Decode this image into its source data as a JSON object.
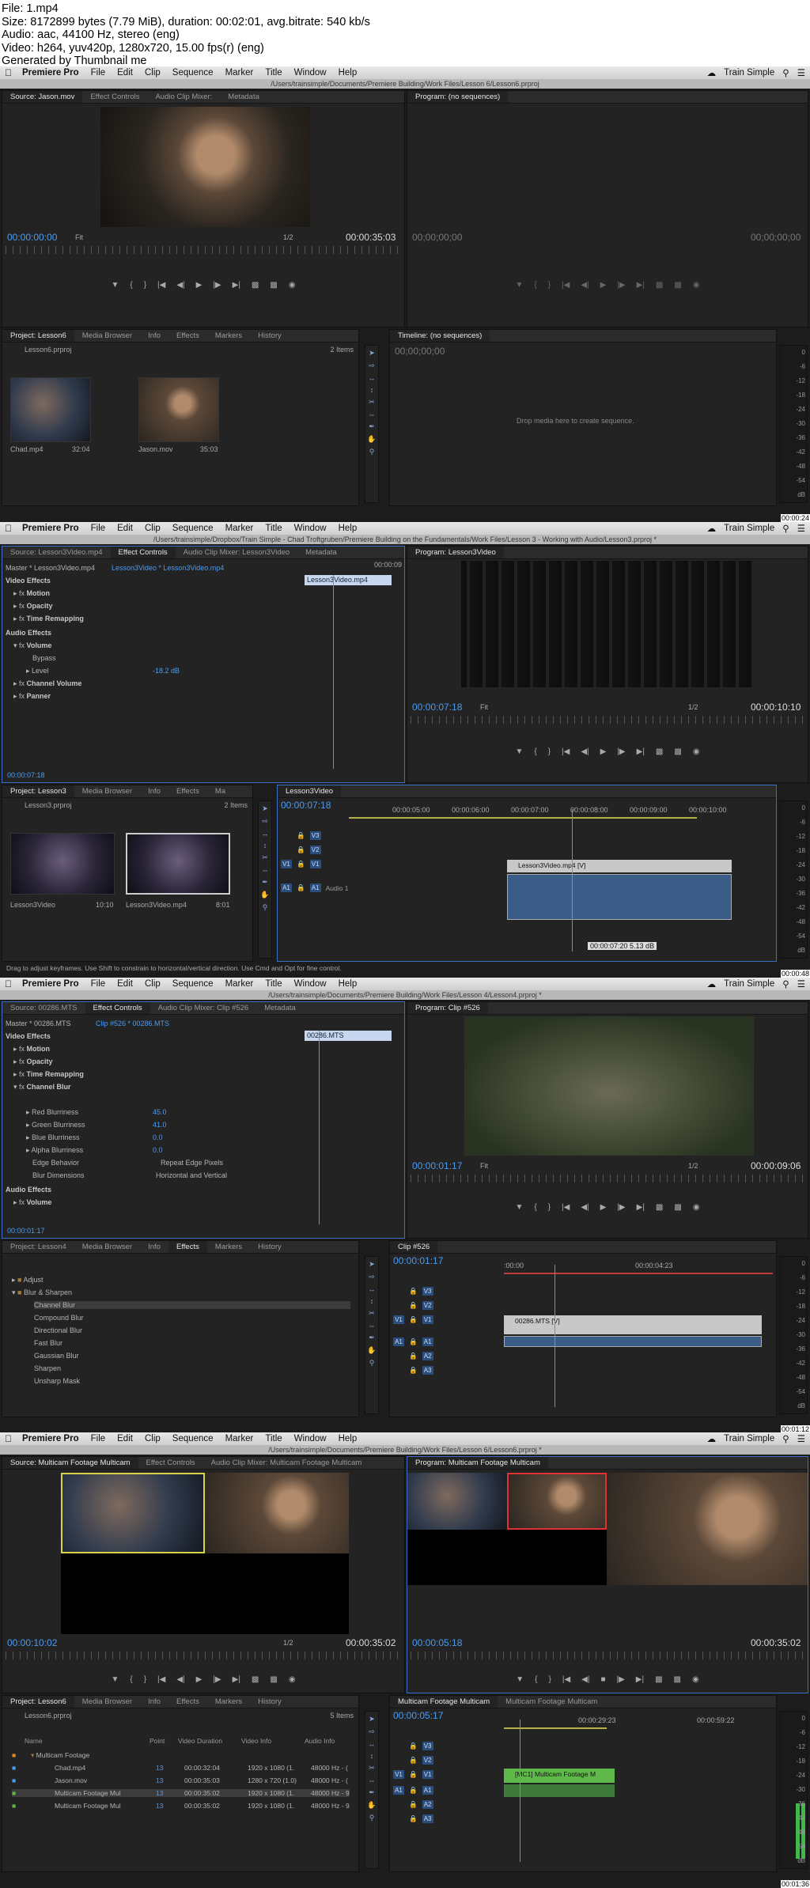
{
  "header": {
    "file": "File: 1.mp4",
    "size": "Size: 8172899 bytes (7.79 MiB), duration: 00:02:01, avg.bitrate: 540 kb/s",
    "audio": "Audio: aac, 44100 Hz, stereo (eng)",
    "video": "Video: h264, yuv420p, 1280x720, 15.00 fps(r) (eng)",
    "generator": "Generated by Thumbnail me"
  },
  "menubar": {
    "app": "Premiere Pro",
    "items": [
      "File",
      "Edit",
      "Clip",
      "Sequence",
      "Marker",
      "Title",
      "Window",
      "Help"
    ],
    "right": "Train Simple"
  },
  "frames": [
    {
      "path": "/Users/trainsimple/Documents/Premiere Building/Work Files/Lesson 6/Lesson6.prproj",
      "timestamp": "00:00:24",
      "source_tabs": [
        "Source: Jason.mov",
        "Effect Controls",
        "Audio Clip Mixer:",
        "Metadata"
      ],
      "program_tab": "Program: (no sequences)",
      "source_tc": "00:00:00:00",
      "fit": "Fit",
      "res": "1/2",
      "source_dur": "00:00:35:03",
      "program_tc_left": "00;00;00;00",
      "program_tc_right": "00;00;00;00",
      "project_tabs": [
        "Project: Lesson6",
        "Media Browser",
        "Info",
        "Effects",
        "Markers",
        "History"
      ],
      "project_file": "Lesson6.prproj",
      "items_count": "2 Items",
      "thumbs": [
        {
          "name": "Chad.mp4",
          "dur": "32:04"
        },
        {
          "name": "Jason.mov",
          "dur": "35:03"
        }
      ],
      "timeline_tab": "Timeline: (no sequences)",
      "timeline_tc": "00;00;00;00",
      "drop_msg": "Drop media here to create sequence."
    },
    {
      "path": "/Users/trainsimple/Dropbox/Train Simple - Chad Troftgruben/Premiere Building on the Fundamentals/Work Files/Lesson 3 - Working with Audio/Lesson3.prproj *",
      "timestamp": "00:00:48",
      "source_tabs": [
        "Source: Lesson3Video.mp4",
        "Effect Controls",
        "Audio Clip Mixer: Lesson3Video",
        "Metadata"
      ],
      "program_tab": "Program: Lesson3Video",
      "ec_master": "Master * Lesson3Video.mp4",
      "ec_clip": "Lesson3Video * Lesson3Video.mp4",
      "ec_time": "00:00:09",
      "ec_cliplabel": "Lesson3Video.mp4",
      "ec_rows": [
        "Video Effects",
        "Motion",
        "Opacity",
        "Time Remapping",
        "Audio Effects",
        "Volume",
        "Bypass",
        "Level",
        "Channel Volume",
        "Panner"
      ],
      "level_value": "-18.2 dB",
      "ec_tc": "00:00:07:18",
      "program_tc": "00:00:07:18",
      "fit": "Fit",
      "res": "1/2",
      "program_dur": "00:00:10:10",
      "project_tabs": [
        "Project: Lesson3",
        "Media Browser",
        "Info",
        "Effects",
        "Ma"
      ],
      "project_file": "Lesson3.prproj",
      "items_count": "2 Items",
      "thumbs": [
        {
          "name": "Lesson3Video",
          "dur": "10:10"
        },
        {
          "name": "Lesson3Video.mp4",
          "dur": "8:01"
        }
      ],
      "timeline_tab": "Lesson3Video",
      "timeline_tc": "00:00:07:18",
      "ruler_labels": [
        "00:00:05:00",
        "00:00:06:00",
        "00:00:07:00",
        "00:00:08:00",
        "00:00:09:00",
        "00:00:10:00"
      ],
      "tracks_v": [
        "V3",
        "V2",
        "V1"
      ],
      "tracks_a": [
        "A1"
      ],
      "audio_track_name": "Audio 1",
      "clip_v": "Lesson3Video.mp4 [V]",
      "tooltip": "00:00:07:20  5.13 dB",
      "status": "Drag to adjust keyframes. Use Shift to constrain to horizontal/vertical direction. Use Cmd and Opt for fine control."
    },
    {
      "path": "/Users/trainsimple/Documents/Premiere Building/Work Files/Lesson 4/Lesson4.prproj *",
      "timestamp": "00:01:12",
      "source_tabs": [
        "Source: 00286.MTS",
        "Effect Controls",
        "Audio Clip Mixer: Clip #526",
        "Metadata"
      ],
      "program_tab": "Program: Clip #526",
      "ec_master": "Master * 00286.MTS",
      "ec_clip": "Clip #526 * 00286.MTS",
      "ec_cliplabel": "00286.MTS",
      "ec_rows": [
        "Video Effects",
        "Motion",
        "Opacity",
        "Time Remapping",
        "Channel Blur",
        "Red Blurriness",
        "Green Blurriness",
        "Blue Blurriness",
        "Alpha Blurriness",
        "Edge Behavior",
        "Blur Dimensions",
        "Audio Effects",
        "Volume"
      ],
      "ec_values": [
        "45.0",
        "41.0",
        "0.0",
        "0.0"
      ],
      "edge_option": "Repeat Edge Pixels",
      "blur_dim": "Horizontal and Vertical",
      "ec_tc": "00:00:01:17",
      "program_tc": "00:00:01:17",
      "fit": "Fit",
      "res": "1/2",
      "program_dur": "00:00:09:06",
      "project_tabs": [
        "Project: Lesson4",
        "Media Browser",
        "Info",
        "Effects",
        "Markers",
        "History"
      ],
      "effects_tree": [
        "Adjust",
        "Blur & Sharpen",
        "Channel Blur",
        "Compound Blur",
        "Directional Blur",
        "Fast Blur",
        "Gaussian Blur",
        "Sharpen",
        "Unsharp Mask"
      ],
      "timeline_tab": "Clip #526",
      "timeline_tc": "00:00:01:17",
      "ruler_labels": [
        ":00:00",
        "00:00:04:23"
      ],
      "tracks_v": [
        "V3",
        "V2",
        "V1"
      ],
      "tracks_a": [
        "A1",
        "A2",
        "A3"
      ],
      "clip_v": "00286.MTS [V]"
    },
    {
      "path": "/Users/trainsimple/Documents/Premiere Building/Work Files/Lesson 6/Lesson6.prproj *",
      "timestamp": "00:01:36",
      "source_tabs": [
        "Source: Multicam Footage Multicam",
        "Effect Controls",
        "Audio Clip Mixer: Multicam Footage Multicam"
      ],
      "program_tab": "Program: Multicam Footage Multicam",
      "source_tc": "00:00:10:02",
      "res": "1/2",
      "source_dur": "00:00:35:02",
      "program_tc": "00:00:05:18",
      "program_dur": "00:00:35:02",
      "project_tabs": [
        "Project: Lesson6",
        "Media Browser",
        "Info",
        "Effects",
        "Markers",
        "History"
      ],
      "project_file": "Lesson6.prproj",
      "items_count": "5 Items",
      "list_headers": [
        "Name",
        "Point",
        "Video Duration",
        "Video Info",
        "Audio Info"
      ],
      "list_rows": [
        {
          "name": "Multicam Footage",
          "pt": "",
          "dur": "",
          "info": "",
          "audio": ""
        },
        {
          "name": "Chad.mp4",
          "pt": "13",
          "dur": "00:00:32:04",
          "info": "1920 x 1080 (1.",
          "audio": "48000 Hz - ("
        },
        {
          "name": "Jason.mov",
          "pt": "13",
          "dur": "00:00:35:03",
          "info": "1280 x 720 (1.0)",
          "audio": "48000 Hz - ("
        },
        {
          "name": "Multicam Footage Mul",
          "pt": "13",
          "dur": "00:00:35:02",
          "info": "1920 x 1080 (1.",
          "audio": "48000 Hz - 9"
        },
        {
          "name": "Multicam Footage Mul",
          "pt": "13",
          "dur": "00:00:35:02",
          "info": "1920 x 1080 (1.",
          "audio": "48000 Hz - 9"
        }
      ],
      "timeline_tabs": [
        "Multicam Footage Multicam",
        "Multicam Footage Multicam"
      ],
      "timeline_tc": "00:00:05:17",
      "ruler_labels": [
        "00:00:29:23",
        "00:00:59:22"
      ],
      "tracks_v": [
        "V3",
        "V2",
        "V1"
      ],
      "tracks_a": [
        "A1",
        "A2",
        "A3"
      ],
      "clip_v": "[MC1] Multicam Footage M"
    }
  ],
  "meter_labels": [
    "0",
    "-6",
    "-12",
    "-18",
    "-24",
    "-30",
    "-36",
    "-42",
    "-48",
    "-54",
    "dB"
  ],
  "colors": {
    "accent": "#4c9bf0",
    "panel": "#232323",
    "clip_green": "#5fb84a",
    "clip_grey": "#c8c8c8"
  }
}
